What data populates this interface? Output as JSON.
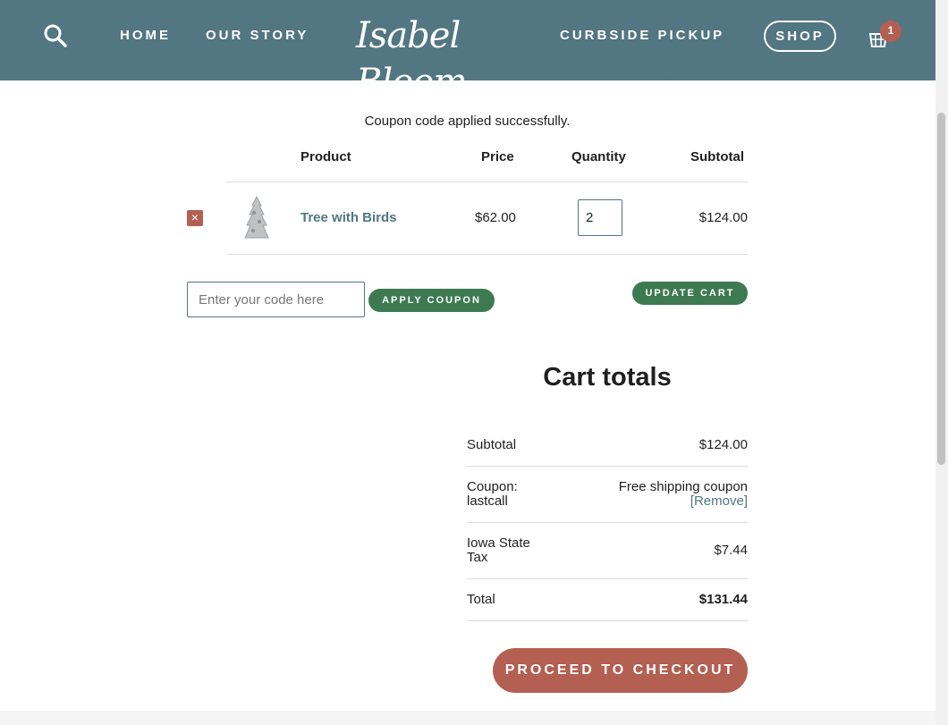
{
  "header": {
    "logo": "Isabel Bloom",
    "nav": [
      "HOME",
      "OUR STORY",
      "CURBSIDE PICKUP"
    ],
    "shop_label": "SHOP",
    "cart_count": "1",
    "icons": {
      "search": "search-icon",
      "cart": "basket-icon"
    }
  },
  "notice": "Coupon code applied successfully.",
  "cart_table": {
    "headers": {
      "product": "Product",
      "price": "Price",
      "quantity": "Quantity",
      "subtotal": "Subtotal"
    },
    "items": [
      {
        "remove": "×",
        "name": "Tree with Birds",
        "price": "$62.00",
        "quantity": "2",
        "subtotal": "$124.00"
      }
    ]
  },
  "coupon": {
    "placeholder": "Enter your code here",
    "apply_label": "APPLY COUPON",
    "update_label": "UPDATE CART"
  },
  "totals": {
    "title": "Cart totals",
    "subtotal_label": "Subtotal",
    "subtotal_value": "$124.00",
    "coupon_label_1": "Coupon:",
    "coupon_label_2": "lastcall",
    "coupon_value": "Free shipping coupon",
    "coupon_remove": "[Remove]",
    "tax_label_1": "Iowa State",
    "tax_label_2": "Tax",
    "tax_value": "$7.44",
    "total_label": "Total",
    "total_value": "$131.44",
    "checkout_label": "PROCEED TO CHECKOUT"
  },
  "colors": {
    "header": "#527682",
    "accent_red": "#b35f52",
    "accent_green": "#3d7a52"
  }
}
